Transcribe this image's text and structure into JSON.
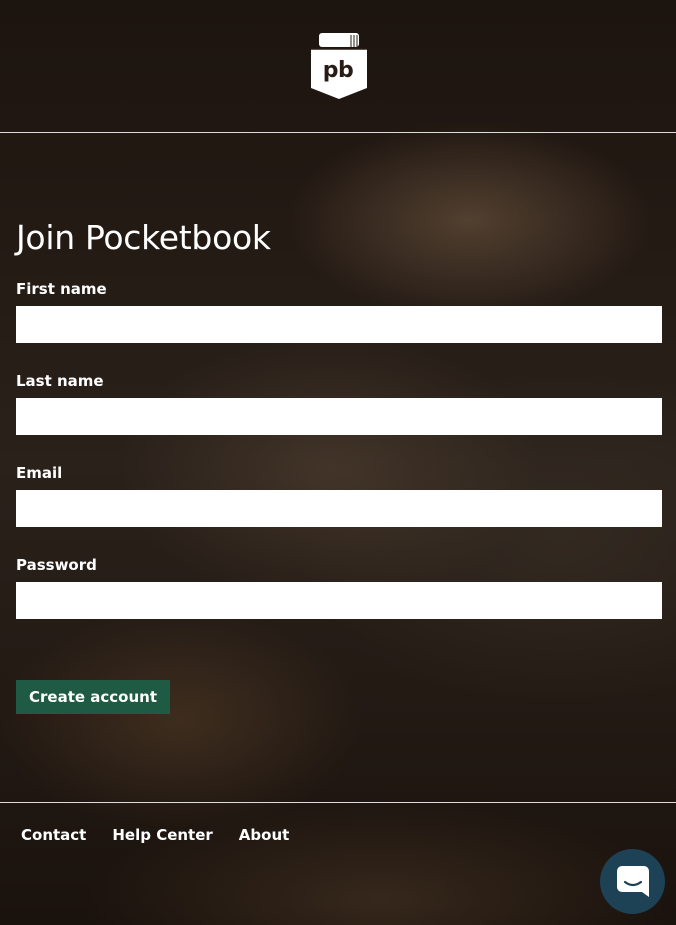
{
  "header": {
    "logo_text": "pb",
    "logo_icon": "pocketbook-logo-icon"
  },
  "form": {
    "title": "Join Pocketbook",
    "fields": [
      {
        "label": "First name",
        "value": "",
        "placeholder": ""
      },
      {
        "label": "Last name",
        "value": "",
        "placeholder": ""
      },
      {
        "label": "Email",
        "value": "",
        "placeholder": ""
      },
      {
        "label": "Password",
        "value": "",
        "placeholder": ""
      }
    ],
    "submit_label": "Create account"
  },
  "footer": {
    "links": [
      "Contact",
      "Help Center",
      "About"
    ]
  },
  "chat": {
    "icon": "chat-bubble-icon"
  },
  "colors": {
    "button_bg": "#1f5a45",
    "chat_bg": "#1d4256",
    "text": "#ffffff"
  }
}
